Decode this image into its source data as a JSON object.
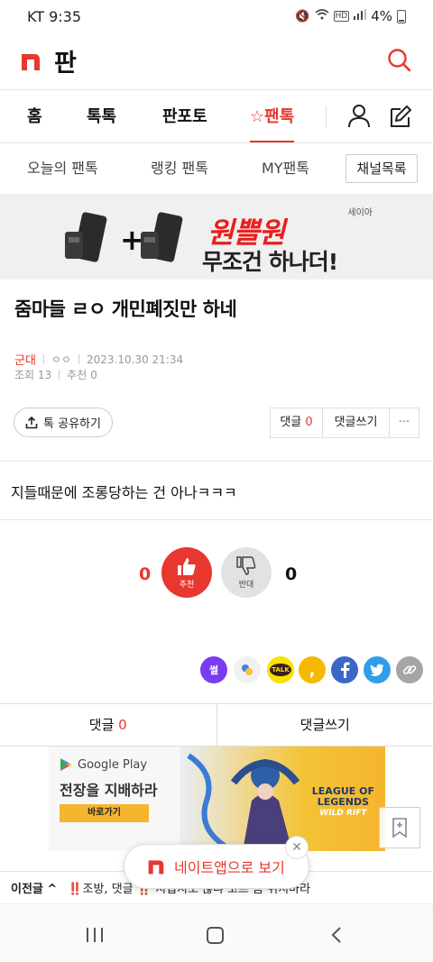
{
  "status": {
    "carrier_time": "KT 9:35",
    "net_badge": "HD",
    "battery": "4%"
  },
  "header": {
    "title": "판",
    "search_icon": "search-icon"
  },
  "main_nav": {
    "tabs": [
      {
        "label": "홈"
      },
      {
        "label": "톡톡"
      },
      {
        "label": "판포토"
      },
      {
        "label": "☆팬톡"
      }
    ]
  },
  "sub_nav": {
    "tabs": [
      {
        "label": "오늘의 팬톡"
      },
      {
        "label": "랭킹 팬톡"
      },
      {
        "label": "MY팬톡"
      }
    ],
    "channel_button": "채널목록"
  },
  "ad_banner": {
    "badge": "세이아",
    "line1": "원쁠원",
    "line2": "무조건 하나더!",
    "plus": "+"
  },
  "post": {
    "title": "줌마들 ㄹㅇ 개민폐짓만 하네",
    "category": "군대",
    "author": "ㅇㅇ",
    "datetime": "2023.10.30 21:34",
    "views": "조회 13",
    "recommends": "추천 0",
    "body": "지들때문에 조롱당하는 건 아나ㅋㅋㅋ"
  },
  "actions": {
    "share": "톡 공유하기",
    "comment_label": "댓글",
    "comment_count": "0",
    "write_comment": "댓글쓰기",
    "more": "···"
  },
  "votes": {
    "up_count": "0",
    "up_label": "추천",
    "down_label": "반대",
    "down_count": "0"
  },
  "social": {
    "ssul": "썰",
    "talk": "TALK",
    "story": ","
  },
  "comment_bar": {
    "comment_label": "댓글",
    "comment_count": "0",
    "write": "댓글쓰기"
  },
  "gp_ad": {
    "brand": "Google Play",
    "title": "전장을 지배하라",
    "button": "바로가기",
    "game_line1": "LEAGUE OF",
    "game_line2": "LEGENDS",
    "game_line3": "WILD RIFT"
  },
  "app_pill": {
    "label": "네이트앱으로 보기"
  },
  "bottom": {
    "prev_label": "이전글",
    "prev_item": "‼️조방, 댓글 ‼️ 지겹지도 않냐 고프 좀 뒤지마라"
  },
  "colors": {
    "accent": "#e8372f",
    "gp_yellow": "#f5b52e"
  }
}
